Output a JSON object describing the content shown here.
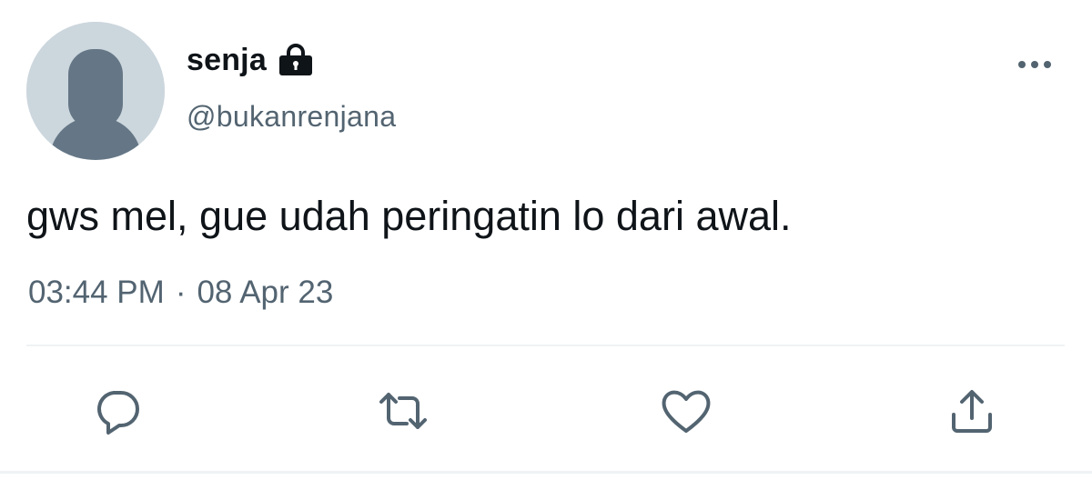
{
  "user": {
    "display_name": "senja",
    "handle": "@bukanrenjana",
    "protected_icon": "lock-icon",
    "avatar": "default-avatar"
  },
  "tweet": {
    "text": "gws mel, gue udah peringatin lo dari awal.",
    "time": "03:44 PM",
    "separator": "·",
    "date": "08 Apr 23"
  },
  "actions": [
    {
      "name": "reply",
      "icon": "reply-icon"
    },
    {
      "name": "retweet",
      "icon": "retweet-icon"
    },
    {
      "name": "like",
      "icon": "heart-icon"
    },
    {
      "name": "share",
      "icon": "share-icon"
    }
  ],
  "menu": {
    "icon": "more-icon"
  },
  "colors": {
    "text_primary": "#0f1419",
    "text_secondary": "#536471",
    "icon": "#536471",
    "avatar_bg": "#ccd6dd",
    "avatar_fg": "#657786",
    "divider": "#eff3f4"
  }
}
